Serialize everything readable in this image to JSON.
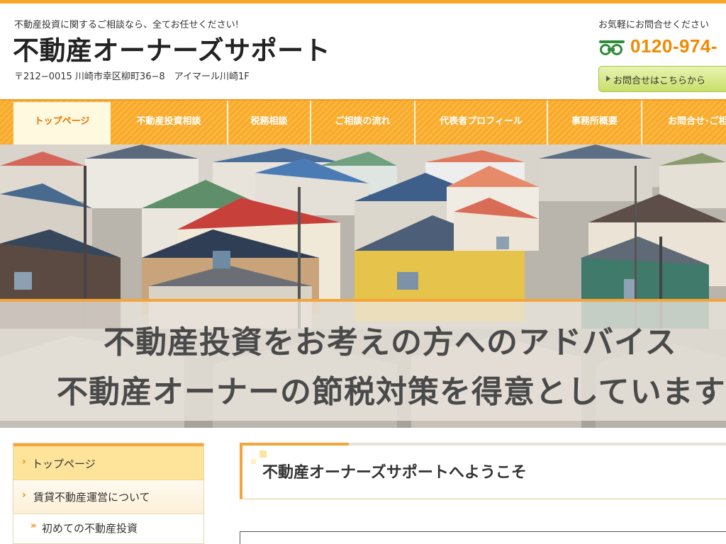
{
  "header": {
    "tagline": "不動産投資に関するご相談なら、全てお任せください!",
    "site_title": "不動産オーナーズサポート",
    "address": "〒212−0015 川崎市幸区柳町36−8　アイマール川崎1F",
    "contact_label": "お気軽にお問合せください",
    "phone": "0120-974-",
    "contact_button": "お問合せはこちらから",
    "freedial_icon": "free-dial-icon"
  },
  "nav": {
    "items": [
      "トップページ",
      "不動産投資相談",
      "税務相談",
      "ご相談の流れ",
      "代表者プロフィール",
      "事務所概要",
      "お問合せ･ご相"
    ]
  },
  "hero": {
    "line1": "不動産投資をお考えの方へのアドバイス",
    "line2": "不動産オーナーの節税対策を得意としています"
  },
  "sidebar": {
    "items": [
      "トップページ",
      "賃貸不動産運営について",
      "初めての不動産投資"
    ]
  },
  "main": {
    "welcome_title": "不動産オーナーズサポートへようこそ"
  },
  "colors": {
    "accent": "#f5a623",
    "phone": "#f08a00",
    "button": "#c8df6a"
  }
}
